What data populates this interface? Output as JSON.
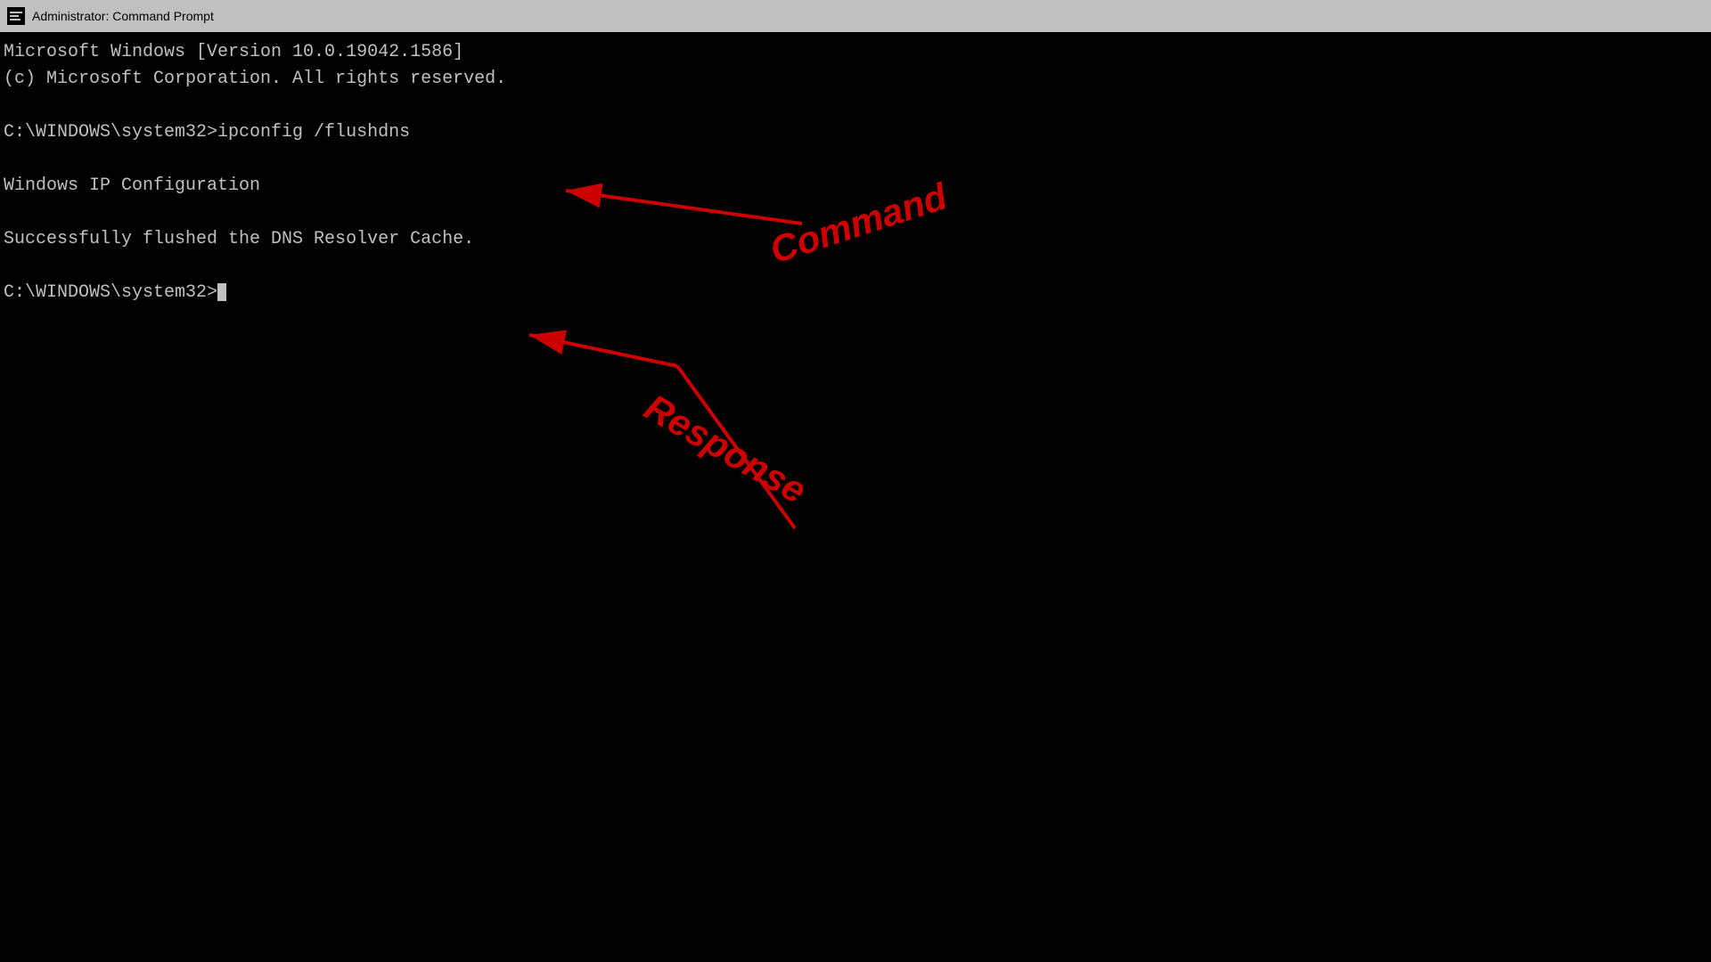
{
  "titlebar": {
    "icon_label": "C:\\",
    "title": "Administrator: Command Prompt"
  },
  "terminal": {
    "lines": [
      "Microsoft Windows [Version 10.0.19042.1586]",
      "(c) Microsoft Corporation. All rights reserved.",
      "",
      "C:\\WINDOWS\\system32>ipconfig /flushdns",
      "",
      "Windows IP Configuration",
      "",
      "Successfully flushed the DNS Resolver Cache.",
      "",
      "C:\\WINDOWS\\system32>_"
    ]
  },
  "annotations": {
    "command_label": "Command",
    "response_label": "Response"
  }
}
